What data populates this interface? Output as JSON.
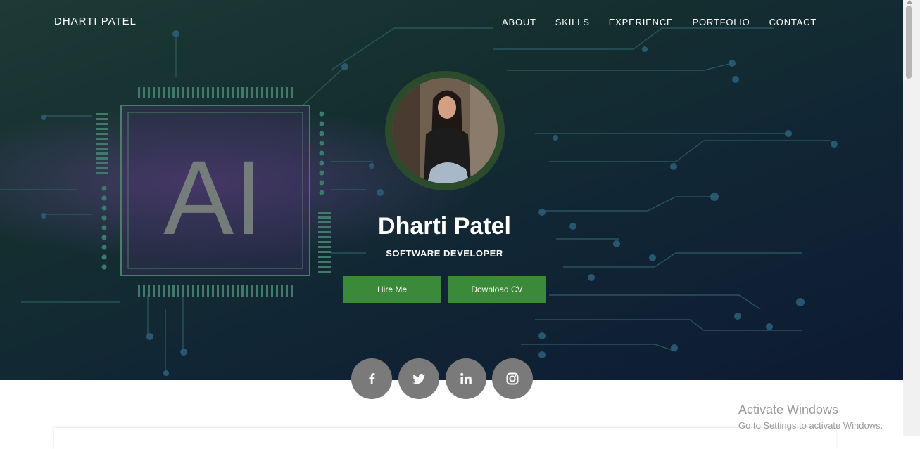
{
  "brand": "DHARTI PATEL",
  "nav": {
    "items": [
      "ABOUT",
      "SKILLS",
      "EXPERIENCE",
      "PORTFOLIO",
      "CONTACT"
    ]
  },
  "hero": {
    "background_text": "AI",
    "name": "Dharti Patel",
    "role": "SOFTWARE DEVELOPER",
    "hire_label": "Hire Me",
    "cv_label": "Download CV"
  },
  "social": [
    "facebook-icon",
    "twitter-icon",
    "linkedin-icon",
    "instagram-icon"
  ],
  "activation": {
    "title": "Activate Windows",
    "subtitle": "Go to Settings to activate Windows."
  },
  "colors": {
    "accent_button": "#3a8a3a",
    "avatar_ring": "#2c4b2c",
    "social_bg": "#7a7a7a"
  }
}
